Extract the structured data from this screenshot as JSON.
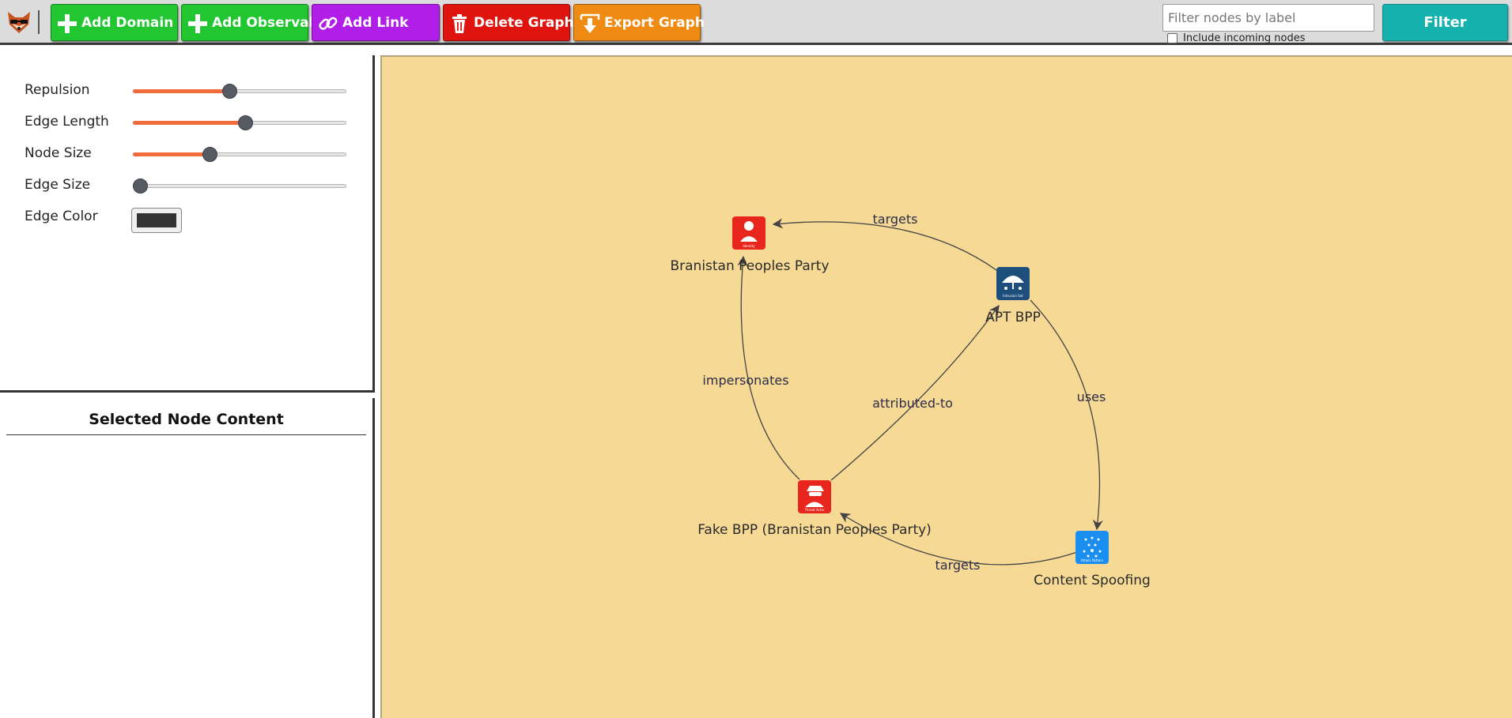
{
  "toolbar": {
    "buttons": {
      "add_domain": {
        "label": "Add Domain",
        "color": "#21c630"
      },
      "add_observable": {
        "label": "Add Observable",
        "color": "#21c630"
      },
      "add_link": {
        "label": "Add Link",
        "color": "#b01ee8"
      },
      "delete_graph": {
        "label": "Delete Graph",
        "color": "#e0140f"
      },
      "export_graph": {
        "label": "Export Graph",
        "color": "#ef8a12"
      }
    },
    "filter": {
      "placeholder": "Filter nodes by label",
      "value": "",
      "include_incoming_label": "Include incoming nodes",
      "include_incoming_checked": false,
      "button_label": "Filter"
    }
  },
  "controls": {
    "repulsion": {
      "label": "Repulsion",
      "value": 0.45
    },
    "edge_length": {
      "label": "Edge Length",
      "value": 0.53
    },
    "node_size": {
      "label": "Node Size",
      "value": 0.35
    },
    "edge_size": {
      "label": "Edge Size",
      "value": 0.0
    },
    "edge_color": {
      "label": "Edge Color",
      "value": "#333333"
    }
  },
  "node_panel": {
    "title": "Selected Node Content"
  },
  "graph": {
    "background": "#f5d995",
    "nodes": {
      "branistan": {
        "label": "Branistan Peoples Party",
        "type_caption": "Identity",
        "icon": "identity-icon",
        "color": "#e8261e"
      },
      "apt": {
        "label": "APT BPP",
        "type_caption": "Intrusion Set",
        "icon": "intrusion-set-icon",
        "color": "#1d4e7c"
      },
      "fake": {
        "label": "Fake BPP (Branistan Peoples Party)",
        "type_caption": "Threat Actor",
        "icon": "threat-actor-icon",
        "color": "#e8261e"
      },
      "spoof": {
        "label": "Content Spoofing",
        "type_caption": "Attack Pattern",
        "icon": "attack-pattern-icon",
        "color": "#1a8ff0"
      }
    },
    "edges": {
      "apt_targets_branistan": {
        "label": "targets",
        "source": "APT BPP",
        "target": "Branistan Peoples Party"
      },
      "apt_uses_spoof": {
        "label": "uses",
        "source": "APT BPP",
        "target": "Content Spoofing"
      },
      "spoof_targets_fake": {
        "label": "targets",
        "source": "Content Spoofing",
        "target": "Fake BPP (Branistan Peoples Party)"
      },
      "fake_attributed_apt": {
        "label": "attributed-to",
        "source": "Fake BPP (Branistan Peoples Party)",
        "target": "APT BPP"
      },
      "fake_impersonates_branistan": {
        "label": "impersonates",
        "source": "Fake BPP (Branistan Peoples Party)",
        "target": "Branistan Peoples Party"
      }
    }
  }
}
